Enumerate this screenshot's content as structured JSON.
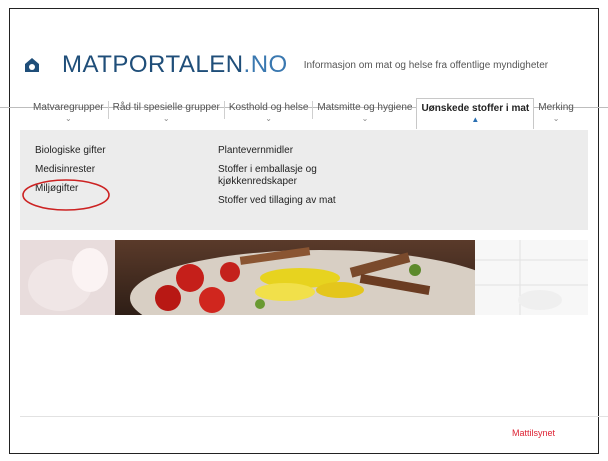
{
  "header": {
    "brand_main": "MATPORTALEN",
    "brand_tld": ".NO",
    "tagline": "Informasjon om mat og helse fra offentlige myndigheter"
  },
  "nav": {
    "items": [
      {
        "label": "Matvaregrupper",
        "active": false
      },
      {
        "label": "Råd til spesielle grupper",
        "active": false
      },
      {
        "label": "Kosthold og helse",
        "active": false
      },
      {
        "label": "Matsmitte og hygiene",
        "active": false
      },
      {
        "label": "Uønskede stoffer i mat",
        "active": true
      },
      {
        "label": "Merking",
        "active": false
      }
    ]
  },
  "dropdown": {
    "col1": [
      "Biologiske gifter",
      "Medisinrester",
      "Miljøgifter"
    ],
    "col2": [
      "Plantevernmidler",
      "Stoffer i emballasje og kjøkkenredskaper",
      "Stoffer ved tillaging av mat"
    ]
  },
  "footer": {
    "logo_text": "Mattilsynet"
  },
  "colors": {
    "brand": "#1f4e79",
    "circle_highlight": "#cc2222",
    "active_indicator": "#2a6fb2"
  }
}
